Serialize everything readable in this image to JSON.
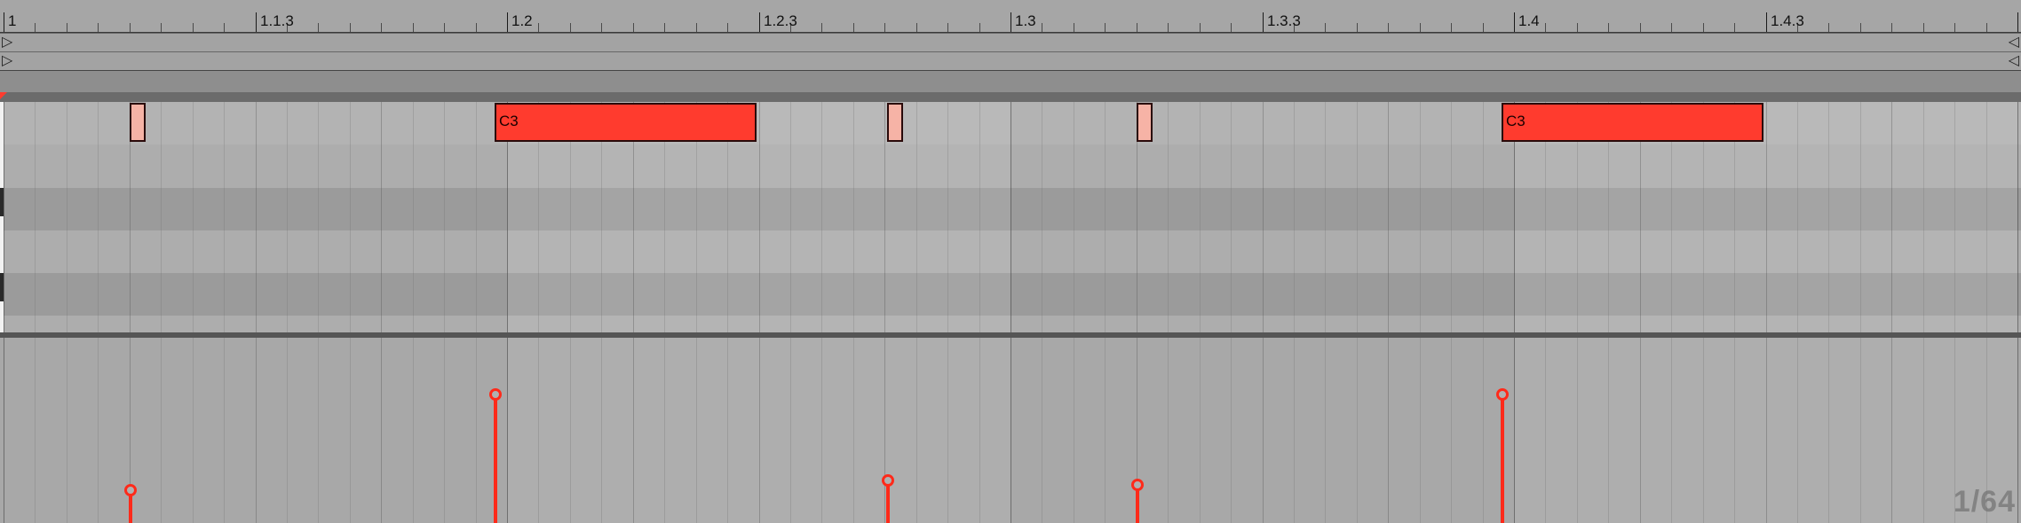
{
  "ruler": {
    "bars": [
      {
        "label": "1",
        "beat": 0
      },
      {
        "label": "1.1.3",
        "beat": 0.5
      },
      {
        "label": "1.2",
        "beat": 1
      },
      {
        "label": "1.2.3",
        "beat": 1.5
      },
      {
        "label": "1.3",
        "beat": 2
      },
      {
        "label": "1.3.3",
        "beat": 2.5
      },
      {
        "label": "1.4",
        "beat": 3
      },
      {
        "label": "1.4.3",
        "beat": 3.5
      }
    ]
  },
  "loop_strip": {
    "start_arrow": "▷",
    "end_arrow": "◁"
  },
  "notes": [
    {
      "name": "",
      "start_beat": 0.25,
      "length_beats": 0.03,
      "row": 0,
      "velocity": 22,
      "ghost": true
    },
    {
      "name": "C3",
      "start_beat": 0.975,
      "length_beats": 0.52,
      "row": 0,
      "velocity": 85,
      "ghost": false
    },
    {
      "name": "",
      "start_beat": 1.755,
      "length_beats": 0.03,
      "row": 0,
      "velocity": 28,
      "ghost": true
    },
    {
      "name": "",
      "start_beat": 2.25,
      "length_beats": 0.03,
      "row": 0,
      "velocity": 25,
      "ghost": true
    },
    {
      "name": "C3",
      "start_beat": 2.975,
      "length_beats": 0.52,
      "row": 0,
      "velocity": 85,
      "ghost": false
    }
  ],
  "grid_readout": "1/64",
  "colors": {
    "note": "#ff3b2e",
    "ghost_note": "#f6b3a6",
    "velocity": "#ff2a1a"
  }
}
